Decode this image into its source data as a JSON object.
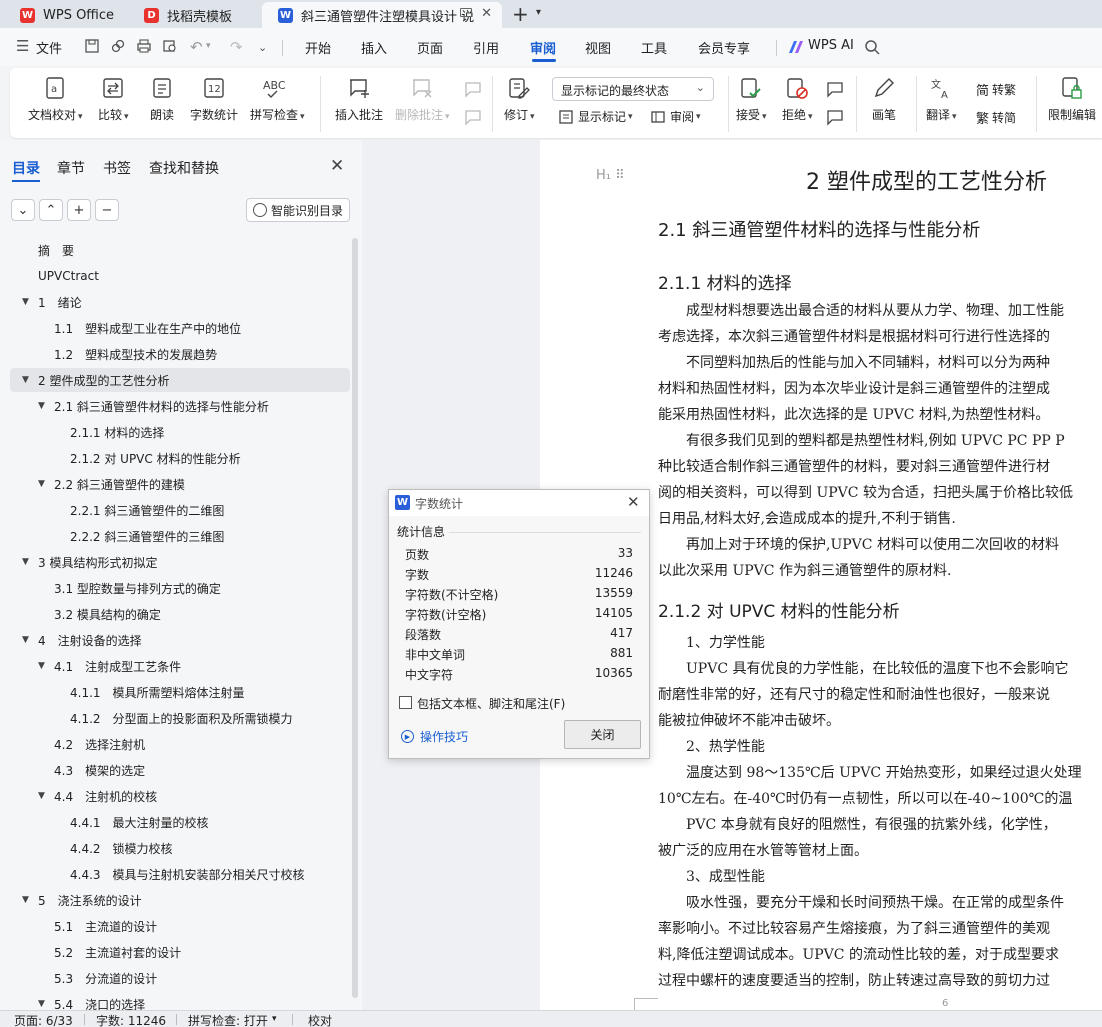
{
  "tabs": [
    {
      "label": "WPS Office",
      "icon": "wps-logo-icon",
      "active": false
    },
    {
      "label": "找稻壳模板",
      "icon": "docer-icon",
      "active": false
    },
    {
      "label": "斜三通管塑件注塑模具设计 说",
      "icon": "writer-doc-icon",
      "active": true
    }
  ],
  "new_tab": "+",
  "menu": {
    "file": "文件",
    "items": [
      "开始",
      "插入",
      "页面",
      "引用",
      "审阅",
      "视图",
      "工具",
      "会员专享"
    ],
    "active": "审阅",
    "wps_ai": "WPS AI"
  },
  "ribbon": {
    "proofread": "文档校对",
    "compare": "比较",
    "read_aloud": "朗读",
    "word_count": "字数统计",
    "spell_check": "拼写检查",
    "insert_comment": "插入批注",
    "delete_comment": "删除批注",
    "revise": "修订",
    "display_mode": "显示标记的最终状态",
    "show_markup": "显示标记",
    "review": "审阅",
    "accept": "接受",
    "reject": "拒绝",
    "pen": "画笔",
    "translate": "翻译",
    "to_traditional": "转繁",
    "to_simplified": "转简",
    "restrict_edit": "限制编辑"
  },
  "nav": {
    "tabs": [
      "目录",
      "章节",
      "书签",
      "查找和替换"
    ],
    "active_tab": "目录",
    "smart_toc": "智能识别目录",
    "items": [
      {
        "label": "摘　要",
        "level": 1,
        "arrow": false
      },
      {
        "label": "UPVCtract",
        "level": 1,
        "arrow": false
      },
      {
        "label": "1　绪论",
        "level": 1,
        "arrow": true
      },
      {
        "label": "1.1　塑料成型工业在生产中的地位",
        "level": 2,
        "arrow": false
      },
      {
        "label": "1.2　塑料成型技术的发展趋势",
        "level": 2,
        "arrow": false
      },
      {
        "label": "2 塑件成型的工艺性分析",
        "level": 1,
        "arrow": true,
        "selected": true
      },
      {
        "label": "2.1 斜三通管塑件材料的选择与性能分析",
        "level": 2,
        "arrow": true
      },
      {
        "label": "2.1.1 材料的选择",
        "level": 3,
        "arrow": false
      },
      {
        "label": "2.1.2  对 UPVC 材料的性能分析",
        "level": 3,
        "arrow": false
      },
      {
        "label": "2.2 斜三通管塑件的建模",
        "level": 2,
        "arrow": true
      },
      {
        "label": "2.2.1 斜三通管塑件的二维图",
        "level": 3,
        "arrow": false
      },
      {
        "label": "2.2.2 斜三通管塑件的三维图",
        "level": 3,
        "arrow": false
      },
      {
        "label": "3 模具结构形式初拟定",
        "level": 1,
        "arrow": true
      },
      {
        "label": "3.1 型腔数量与排列方式的确定",
        "level": 2,
        "arrow": false
      },
      {
        "label": "3.2 模具结构的确定",
        "level": 2,
        "arrow": false
      },
      {
        "label": "4　注射设备的选择",
        "level": 1,
        "arrow": true
      },
      {
        "label": "4.1　注射成型工艺条件",
        "level": 2,
        "arrow": true
      },
      {
        "label": "4.1.1　模具所需塑料熔体注射量",
        "level": 3,
        "arrow": false
      },
      {
        "label": "4.1.2　分型面上的投影面积及所需锁模力",
        "level": 3,
        "arrow": false
      },
      {
        "label": "4.2　选择注射机",
        "level": 2,
        "arrow": false
      },
      {
        "label": "4.3　模架的选定",
        "level": 2,
        "arrow": false
      },
      {
        "label": "4.4　注射机的校核",
        "level": 2,
        "arrow": true
      },
      {
        "label": "4.4.1　最大注射量的校核",
        "level": 3,
        "arrow": false
      },
      {
        "label": "4.4.2　锁模力校核",
        "level": 3,
        "arrow": false
      },
      {
        "label": "4.4.3　模具与注射机安装部分相关尺寸校核",
        "level": 3,
        "arrow": false
      },
      {
        "label": "5　浇注系统的设计",
        "level": 1,
        "arrow": true
      },
      {
        "label": "5.1　主流道的设计",
        "level": 2,
        "arrow": false
      },
      {
        "label": "5.2　主流道衬套的设计",
        "level": 2,
        "arrow": false
      },
      {
        "label": "5.3　分流道的设计",
        "level": 2,
        "arrow": false
      },
      {
        "label": "5.4　浇口的选择",
        "level": 2,
        "arrow": true
      }
    ]
  },
  "doc": {
    "heading_marker": "H₁ ⠿",
    "h1": "2 塑件成型的工艺性分析",
    "h2": "2.1 斜三通管塑件材料的选择与性能分析",
    "h3a": "2.1.1 材料的选择",
    "h3b": "2.1.2 对 UPVC 材料的性能分析",
    "lines_a": [
      "　　成型材料想要选出最合适的材料从要从力学、物理、加工性能",
      "考虑选择，本次斜三通管塑件材料是根据材料可行进行性选择的",
      "　　不同塑料加热后的性能与加入不同辅料，材料可以分为两种",
      "材料和热固性材料，因为本次毕业设计是斜三通管塑件的注塑成",
      "能采用热固性材料，此次选择的是 UPVC 材料,为热塑性材料。",
      "　　有很多我们见到的塑料都是热塑性材料,例如 UPVC PC PP P",
      "种比较适合制作斜三通管塑件的材料，要对斜三通管塑件进行材",
      "阅的相关资料，可以得到 UPVC 较为合适，扫把头属于价格比较低",
      "日用品,材料太好,会造成成本的提升,不利于销售.",
      "　　再加上对于环境的保护,UPVC 材料可以使用二次回收的材料",
      "以此次采用 UPVC 作为斜三通管塑件的原材料."
    ],
    "lines_b": [
      "　　1、力学性能",
      "　　UPVC 具有优良的力学性能，在比较低的温度下也不会影响它",
      "耐磨性非常的好，还有尺寸的稳定性和耐油性也很好，一般来说",
      "能被拉伸破坏不能冲击破坏。",
      "　　2、热学性能",
      "　　温度达到 98～135℃后 UPVC 开始热变形，如果经过退火处理",
      "10℃左右。在-40℃时仍有一点韧性，所以可以在-40~100℃的温",
      "　　PVC 本身就有良好的阻燃性，有很强的抗紫外线，化学性，",
      "被广泛的应用在水管等管材上面。",
      "　　3、成型性能",
      "　　吸水性强，要充分干燥和长时间预热干燥。在正常的成型条件",
      "率影响小。不过比较容易产生熔接痕，为了斜三通管塑件的美观",
      "料,降低注塑调试成本。UPVC 的流动性比较的差，对于成型要求",
      "过程中螺杆的速度要适当的控制，防止转速过高导致的剪切力过"
    ],
    "page_number": "6"
  },
  "dialog": {
    "title": "字数统计",
    "section": "统计信息",
    "stats": [
      {
        "label": "页数",
        "value": "33"
      },
      {
        "label": "字数",
        "value": "11246"
      },
      {
        "label": "字符数(不计空格)",
        "value": "13559"
      },
      {
        "label": "字符数(计空格)",
        "value": "14105"
      },
      {
        "label": "段落数",
        "value": "417"
      },
      {
        "label": "非中文单词",
        "value": "881"
      },
      {
        "label": "中文字符",
        "value": "10365"
      }
    ],
    "checkbox": "包括文本框、脚注和尾注(F)",
    "checkbox_checked": false,
    "tips": "操作技巧",
    "close": "关闭"
  },
  "status": {
    "page": "页面: 6/33",
    "words": "字数: 11246",
    "spell": "拼写检查: 打开",
    "proof": "校对"
  },
  "colors": {
    "accent": "#1a5fd1",
    "wps_red": "#e8322e",
    "writer_blue": "#2b5fd9"
  }
}
